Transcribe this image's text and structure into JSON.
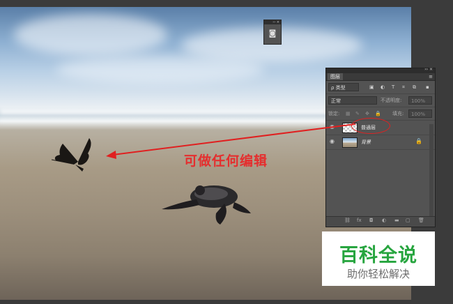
{
  "canvas": {
    "image_subject": "beach-with-turtle-and-butterfly"
  },
  "mini_panel": {
    "icon": "layers-icon"
  },
  "layers_panel": {
    "tab_label": "图层",
    "filter_kind": "ρ 类型",
    "blend_mode": "正常",
    "opacity_label": "不透明度:",
    "opacity_value": "100%",
    "lock_label": "锁定:",
    "fill_label": "填充:",
    "fill_value": "100%",
    "layers": [
      {
        "name": "普通层",
        "visible": true,
        "thumbnail": "transparent-checkerboard",
        "locked": false
      },
      {
        "name": "背景",
        "visible": true,
        "thumbnail": "beach-photo",
        "locked": true
      }
    ]
  },
  "annotation": {
    "text": "可做任何编辑",
    "color": "#e52e2e"
  },
  "watermark": {
    "brand": "百科全说",
    "slogan": "助你轻松解决",
    "brand_color": "#27a53f"
  }
}
